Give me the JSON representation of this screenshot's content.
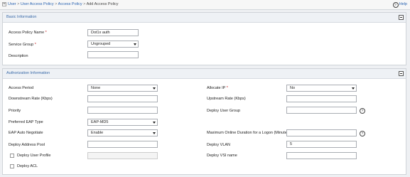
{
  "breadcrumb": {
    "items": [
      "User",
      "User Access Policy",
      "Access Policy"
    ],
    "separator": ">",
    "current": "Add Access Policy"
  },
  "help_label": "Help",
  "basic": {
    "title": "Basic Information",
    "access_policy_name": {
      "label": "Access Policy Name",
      "value": "Dot1x auth"
    },
    "service_group": {
      "label": "Service Group",
      "value": "Ungrouped"
    },
    "description": {
      "label": "Description",
      "value": ""
    }
  },
  "auth": {
    "title": "Authorization Information",
    "access_period": {
      "label": "Access Period",
      "value": "None"
    },
    "allocate_ip": {
      "label": "Allocate IP",
      "value": "No"
    },
    "downstream_rate": {
      "label": "Downstream Rate (Kbps)",
      "value": ""
    },
    "upstream_rate": {
      "label": "Upstream Rate (Kbps)",
      "value": ""
    },
    "priority": {
      "label": "Priority",
      "value": ""
    },
    "deploy_user_group": {
      "label": "Deploy User Group",
      "value": ""
    },
    "preferred_eap_type": {
      "label": "Preferred EAP Type",
      "value": "EAP-MD5"
    },
    "eap_auto_negotiate": {
      "label": "EAP Auto Negotiate",
      "value": "Enable"
    },
    "max_online_duration": {
      "label": "Maximum Online Duration for a Logon (Minutes)",
      "value": ""
    },
    "deploy_address_pool": {
      "label": "Deploy Address Pool",
      "value": ""
    },
    "deploy_vlan": {
      "label": "Deploy VLAN",
      "value": "5"
    },
    "deploy_user_profile": {
      "label": "Deploy User Profile",
      "value": "",
      "checked": false
    },
    "deploy_vsi_name": {
      "label": "Deploy VSI name",
      "value": ""
    },
    "deploy_acl": {
      "label": "Deploy ACL",
      "checked": false
    }
  },
  "required_mark": "*",
  "help_icon_glyph": "?",
  "colors": {
    "link": "#2a63b1",
    "section_title": "#3a6aa8",
    "required": "#c21818"
  }
}
